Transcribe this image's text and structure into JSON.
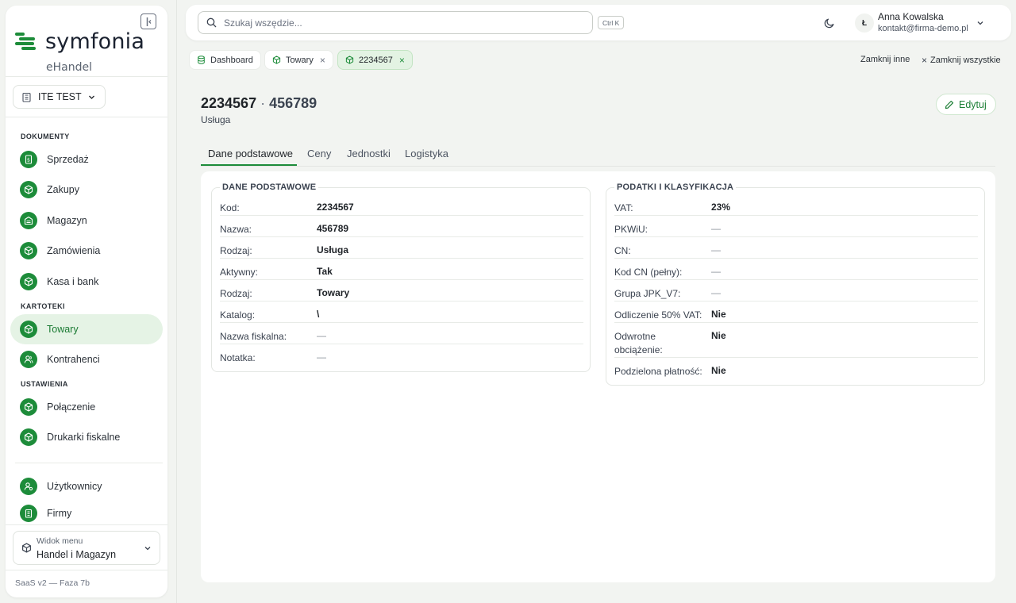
{
  "brand": {
    "name": "symfonia",
    "subtitle": "eHandel"
  },
  "tenant": {
    "label": "ITE TEST"
  },
  "sidebar": {
    "sections": [
      {
        "label": "DOKUMENTY"
      },
      {
        "label": "KARTOTEKI"
      },
      {
        "label": "USTAWIENIA"
      }
    ],
    "items": [
      {
        "label": "Sprzedaż",
        "icon": "dollar-doc-icon"
      },
      {
        "label": "Zakupy",
        "icon": "box-icon"
      },
      {
        "label": "Magazyn",
        "icon": "warehouse-icon"
      },
      {
        "label": "Zamówienia",
        "icon": "box-icon"
      },
      {
        "label": "Kasa i bank",
        "icon": "box-icon"
      },
      {
        "label": "Towary",
        "icon": "box-icon",
        "active": true
      },
      {
        "label": "Kontrahenci",
        "icon": "users-icon"
      },
      {
        "label": "Połączenie",
        "icon": "box-icon"
      },
      {
        "label": "Drukarki fiskalne",
        "icon": "box-icon"
      },
      {
        "label": "Użytkownicy",
        "icon": "user-gear-icon"
      },
      {
        "label": "Firmy",
        "icon": "building-icon"
      }
    ],
    "menu_view": {
      "label": "Widok menu",
      "value": "Handel i Magazyn"
    },
    "version": "SaaS v2 — Faza 7b"
  },
  "search": {
    "placeholder": "Szukaj wszędzie...",
    "shortcut": "Ctrl K"
  },
  "user": {
    "initial": "Ł",
    "name": "Anna Kowalska",
    "email": "kontakt@firma-demo.pl"
  },
  "tabs": [
    {
      "label": "Dashboard",
      "closable": false
    },
    {
      "label": "Towary",
      "closable": true
    },
    {
      "label": "2234567",
      "closable": true,
      "active": true
    }
  ],
  "tab_actions": {
    "close_others": "Zamknij inne",
    "close_all": "Zamknij wszystkie"
  },
  "page": {
    "code": "2234567",
    "separator": "·",
    "name": "456789",
    "subtitle": "Usługa",
    "edit_label": "Edytuj"
  },
  "subtabs": [
    "Dane podstawowe",
    "Ceny",
    "Jednostki",
    "Logistyka"
  ],
  "basic": {
    "title": "DANE PODSTAWOWE",
    "rows": [
      {
        "k": "Kod:",
        "v": "2234567"
      },
      {
        "k": "Nazwa:",
        "v": "456789"
      },
      {
        "k": "Rodzaj:",
        "v": "Usługa"
      },
      {
        "k": "Aktywny:",
        "v": "Tak"
      },
      {
        "k": "Rodzaj:",
        "v": "Towary"
      },
      {
        "k": "Katalog:",
        "v": "\\"
      },
      {
        "k": "Nazwa fiskalna:",
        "v": "—"
      },
      {
        "k": "Notatka:",
        "v": "—"
      }
    ]
  },
  "tax": {
    "title": "PODATKI I KLASYFIKACJA",
    "rows": [
      {
        "k": "VAT:",
        "v": "23%"
      },
      {
        "k": "PKWiU:",
        "v": "—"
      },
      {
        "k": "CN:",
        "v": "—"
      },
      {
        "k": "Kod CN (pełny):",
        "v": "—"
      },
      {
        "k": "Grupa JPK_V7:",
        "v": "—"
      },
      {
        "k": "Odliczenie 50% VAT:",
        "v": "Nie"
      },
      {
        "k": "Odwrotne obciążenie:",
        "v": "Nie"
      },
      {
        "k": "Podzielona płatność:",
        "v": "Nie"
      }
    ]
  },
  "colors": {
    "accent": "#1d8c3a",
    "active_bg": "#e5f3e5",
    "background": "#f2f4f1"
  }
}
